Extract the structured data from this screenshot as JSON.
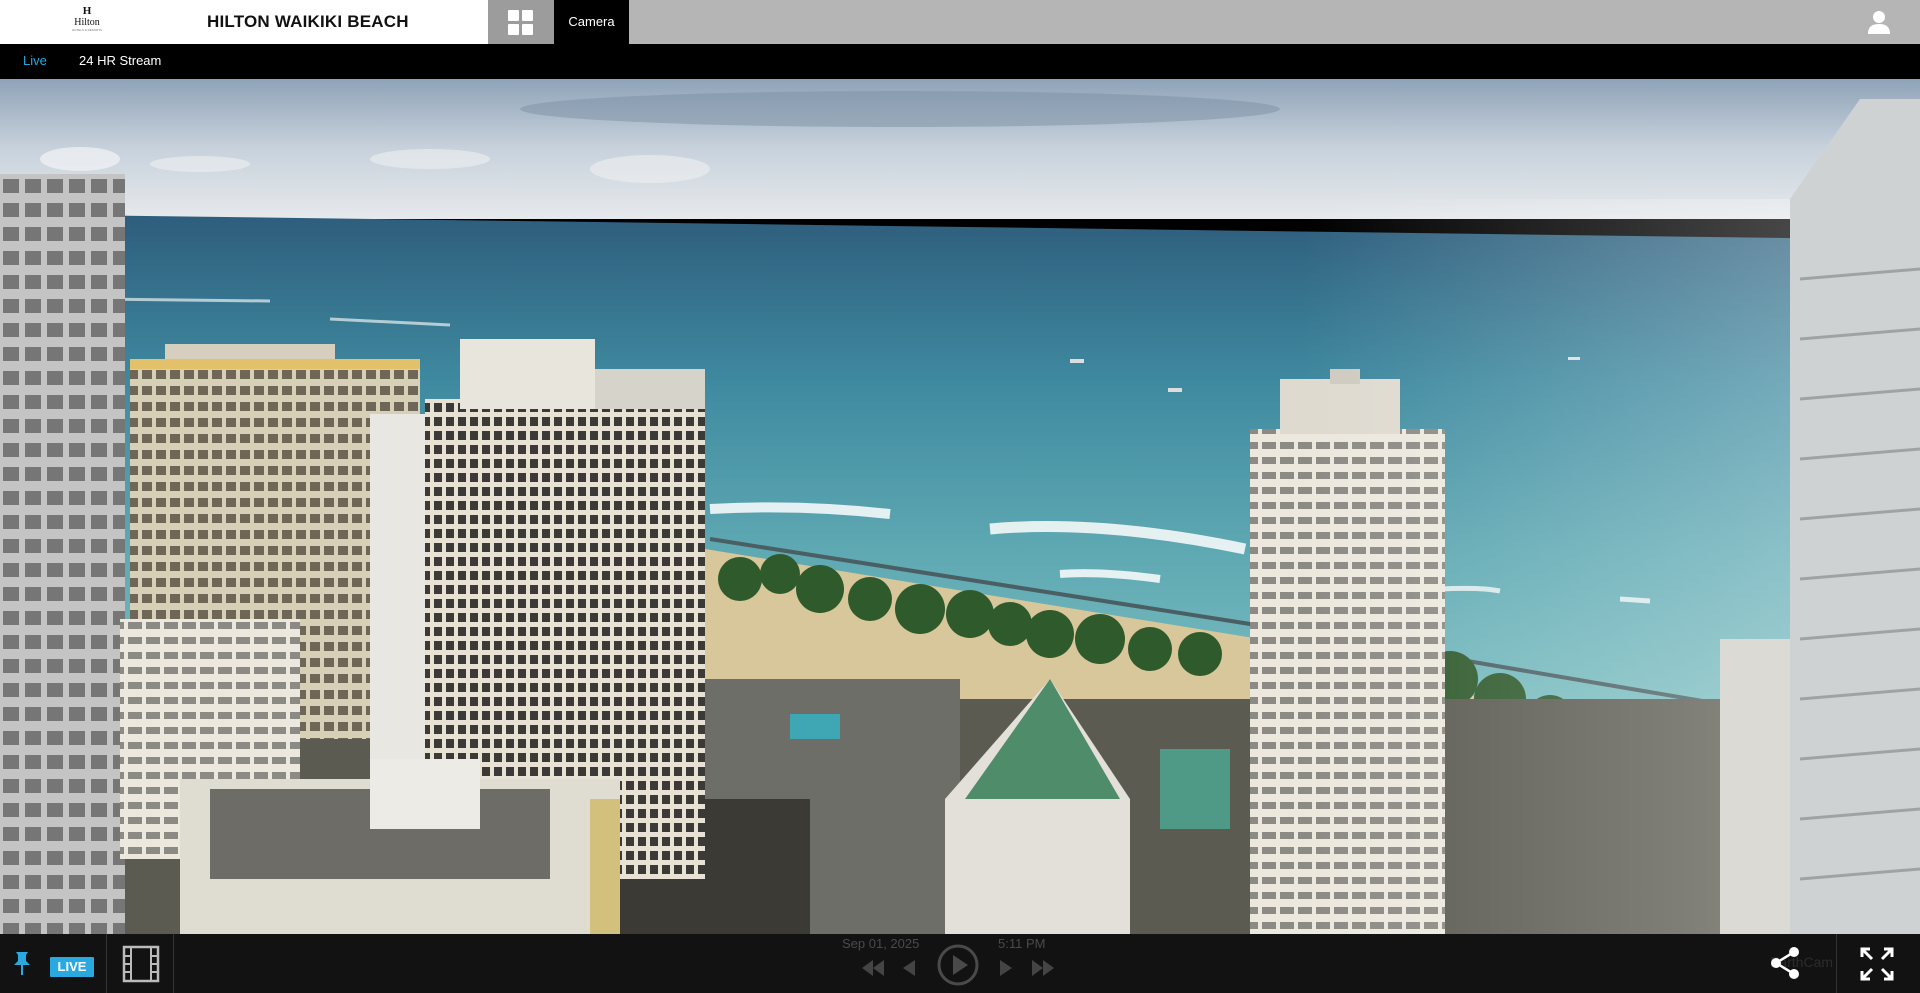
{
  "header": {
    "logo_mark": "H",
    "logo_word": "Hilton",
    "logo_tagline": "HOTELS & RESORTS",
    "hotel_name": "HILTON WAIKIKI BEACH",
    "camera_tab": "Camera"
  },
  "subnav": {
    "items": [
      {
        "label": "Live",
        "active": true
      },
      {
        "label": "24 HR Stream",
        "active": false
      }
    ]
  },
  "player": {
    "live_label": "LIVE",
    "date": "Sep 01, 2025",
    "time": "5:11 PM",
    "watermark": "EarthCam"
  },
  "colors": {
    "accent": "#29a9e0",
    "header_gray": "#b5b5b5",
    "bar": "#141414"
  },
  "icons": [
    "hilton-logo",
    "grid-icon",
    "user-icon",
    "pin-icon",
    "film-icon",
    "skip-back-icon",
    "step-back-icon",
    "play-icon",
    "step-forward-icon",
    "skip-forward-icon",
    "share-icon",
    "fullscreen-icon"
  ]
}
